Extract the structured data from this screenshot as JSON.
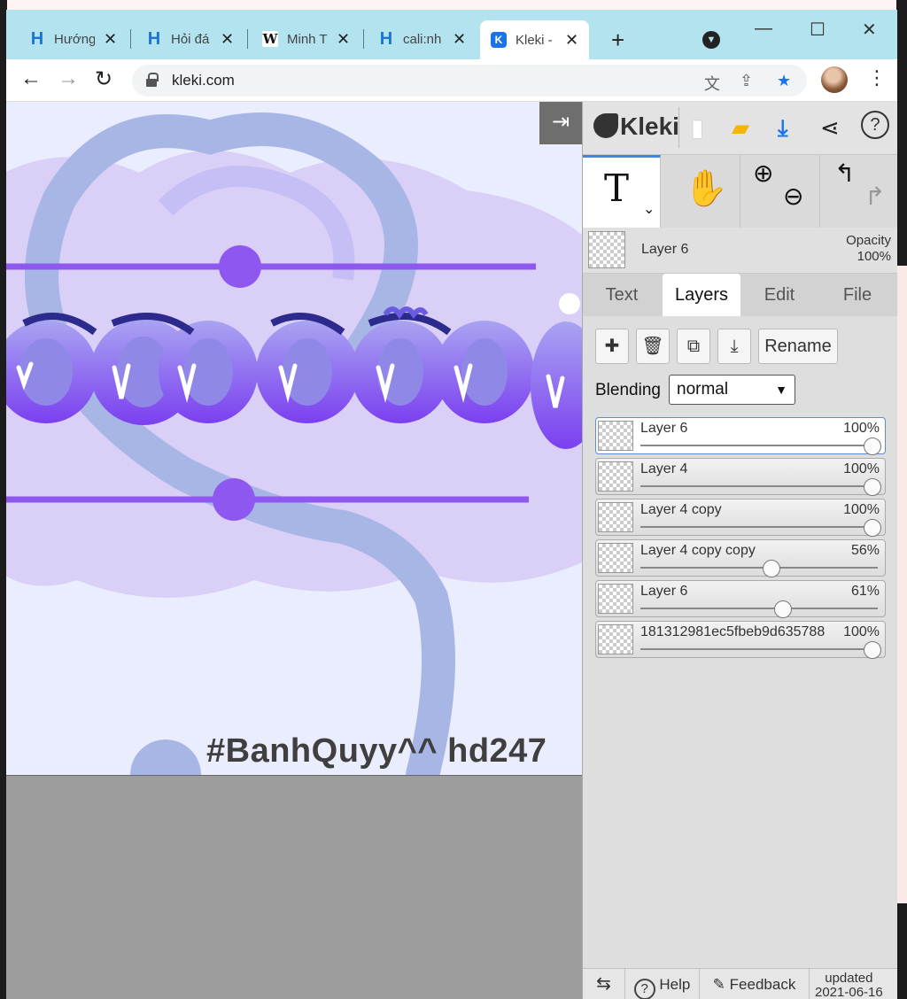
{
  "browser": {
    "tabs": [
      {
        "title": "Hướng",
        "icon": "hoidap-icon"
      },
      {
        "title": "Hỏi đá",
        "icon": "hoidap-icon"
      },
      {
        "title": "Minh T",
        "icon": "wikipedia-icon"
      },
      {
        "title": "cali:nh",
        "icon": "hoidap-icon"
      },
      {
        "title": "Kleki -",
        "icon": "kleki-icon",
        "active": true
      }
    ],
    "url": "kleki.com"
  },
  "canvas": {
    "hashtag_text": "#BanhQuyy^^  hd247"
  },
  "sidebar": {
    "brand": "Kleki",
    "current_layer": {
      "name": "Layer 6",
      "opacity_label": "Opacity",
      "opacity": "100%"
    },
    "panel_tabs": [
      "Text",
      "Layers",
      "Edit",
      "File"
    ],
    "active_tab": "Layers",
    "rename_label": "Rename",
    "blending_label": "Blending",
    "blending_value": "normal",
    "layers": [
      {
        "name": "Layer 6",
        "opacity": "100%",
        "value": 1.0,
        "selected": true
      },
      {
        "name": "Layer 4",
        "opacity": "100%",
        "value": 1.0
      },
      {
        "name": "Layer 4 copy",
        "opacity": "100%",
        "value": 1.0
      },
      {
        "name": "Layer 4 copy copy",
        "opacity": "56%",
        "value": 0.56
      },
      {
        "name": "Layer 6",
        "opacity": "61%",
        "value": 0.61
      },
      {
        "name": "181312981ec5fbeb9d635788",
        "opacity": "100%",
        "value": 1.0
      }
    ],
    "footer": {
      "help": "Help",
      "feedback": "Feedback",
      "updated_label": "updated",
      "updated_date": "2021-06-16"
    }
  },
  "colors": {
    "tabstrip": "#b3e3ee",
    "canvas_bg": "#e9edfd",
    "accent_purple": "#8b5cf6",
    "hashtag": "#3f3f3f",
    "download_blue": "#1a73e8",
    "folder_yellow": "#f4b400"
  }
}
